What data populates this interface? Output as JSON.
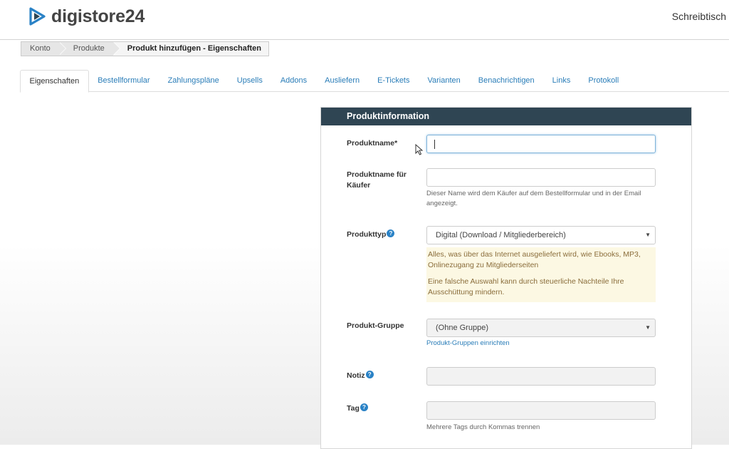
{
  "header": {
    "brand": "digistore24",
    "right_link": "Schreibtisch",
    "brand_color": "#2a82c6"
  },
  "breadcrumb": [
    {
      "label": "Konto"
    },
    {
      "label": "Produkte"
    },
    {
      "label": "Produkt hinzufügen - Eigenschaften"
    }
  ],
  "tabs": [
    {
      "label": "Eigenschaften",
      "active": true
    },
    {
      "label": "Bestellformular"
    },
    {
      "label": "Zahlungspläne"
    },
    {
      "label": "Upsells"
    },
    {
      "label": "Addons"
    },
    {
      "label": "Ausliefern"
    },
    {
      "label": "E-Tickets"
    },
    {
      "label": "Varianten"
    },
    {
      "label": "Benachrichtigen"
    },
    {
      "label": "Links"
    },
    {
      "label": "Protokoll"
    }
  ],
  "panel": {
    "title": "Produktinformation",
    "fields": {
      "produktname": {
        "label": "Produktname*",
        "value": ""
      },
      "kaeufername": {
        "label": "Produktname für Käufer",
        "value": "",
        "help": "Dieser Name wird dem Käufer auf dem Bestellformular und in der Email angezeigt."
      },
      "produkttyp": {
        "label": "Produkttyp",
        "selected": "Digital (Download / Mitgliederbereich)",
        "warning_1": "Alles, was über das Internet ausgeliefert wird, wie Ebooks, MP3, Onlinezugang zu Mitgliederseiten",
        "warning_2": "Eine falsche Auswahl kann durch steuerliche Nachteile Ihre Ausschüttung mindern."
      },
      "gruppe": {
        "label": "Produkt-Gruppe",
        "selected": "(Ohne Gruppe)",
        "link": "Produkt-Gruppen einrichten"
      },
      "notiz": {
        "label": "Notiz",
        "value": ""
      },
      "tag": {
        "label": "Tag",
        "value": "",
        "help": "Mehrere Tags durch Kommas trennen"
      }
    }
  }
}
